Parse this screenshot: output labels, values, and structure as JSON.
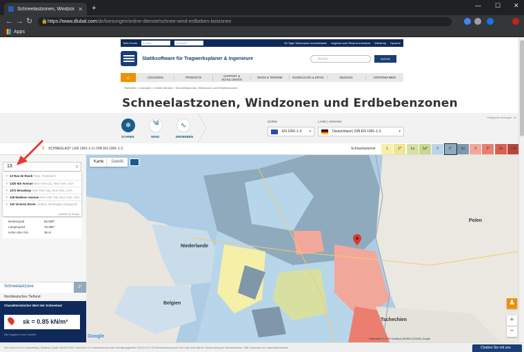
{
  "browser": {
    "tab_title": "Schneelastzonen, Windzonen und",
    "url_domain": "https://www.dlubal.com",
    "url_path": "/de/loesungen/online-dienste/schnee-wind-erdbeben-lastzonen",
    "bookmarks_apps": "Apps"
  },
  "site": {
    "topbar": {
      "my_account": "Mein Konto",
      "email_placeholder": "E-Mail",
      "password_placeholder": "Passwort",
      "trial": "90-Tage-Testversion herunterladen",
      "callback": "Angebot oder Rückruf anfordern",
      "webshop": "Webshop",
      "language": "Sprache"
    },
    "brand": "Statiksoftware für Tragwerksplaner & Ingenieure",
    "search_placeholder": "Suche",
    "search_button": "SUCHE",
    "menu": [
      "LÖSUNGEN",
      "PRODUKTE",
      "SUPPORT & SCHULUNGEN",
      "NEWS & TERMINE",
      "DOWNLOADS & INFOS",
      "BILDUNG",
      "UNTERNEHMEN"
    ],
    "breadcrumb": "Startseite  >  Lösungen  >  Online-Dienste  >  Schneelastzonen, Windzonen und Erdbebenzonen",
    "page_title": "Schneelastzonen, Windzonen und Erdbebenzonen",
    "hint": "Geltigkeits-Anfragen: 10"
  },
  "load_types": [
    {
      "label": "SCHNEE",
      "icon": "❄"
    },
    {
      "label": "WIND",
      "icon": "༄"
    },
    {
      "label": "ERDBEBEN",
      "icon": "∿"
    }
  ],
  "norm": {
    "label": "NORM",
    "value": "EN 1991-1-3"
  },
  "land": {
    "label": "LAND | ANHANG",
    "value": "Deutschland | DIN EN 1991-1-3"
  },
  "strip": {
    "text": "SCHNEELAST  |  EN 1991-1-3  |  DIN EN 1991-1-3",
    "zone_label": "Schneelastzone",
    "zones": [
      {
        "label": "1",
        "color": "#f5efa8"
      },
      {
        "label": "1*",
        "color": "#efe692"
      },
      {
        "label": "1a",
        "color": "#d7e0a0"
      },
      {
        "label": "1a*",
        "color": "#c8d890"
      },
      {
        "label": "2",
        "color": "#b8d6ea"
      },
      {
        "label": "2*",
        "color": "#8faabd"
      },
      {
        "label": "2a",
        "color": "#7f97a8"
      },
      {
        "label": "3",
        "color": "#f2a79b"
      },
      {
        "label": "3*",
        "color": "#ea7f70"
      },
      {
        "label": "3a",
        "color": "#d9604f"
      },
      {
        "label": ">3a",
        "color": "#b8453a"
      }
    ]
  },
  "map": {
    "tab_map": "Karte",
    "tab_satellite": "Satellit",
    "countries": {
      "polen": "Polen",
      "niederlande": "Niederlande",
      "belgien": "Belgien",
      "tschechien": "Tschechien"
    },
    "copyright": "Kartendaten © 2019 GeoBasis-DE/BKG (©2009), Google",
    "google": "Google",
    "zoom_in": "+",
    "zoom_out": "−"
  },
  "panel": {
    "search_value": "13",
    "suggestions": [
      {
        "name": "13 Rue de Rivoli",
        "place": "Paris, Frankreich"
      },
      {
        "name": "1330 6th Avenue",
        "place": "New York City, New York, USA"
      },
      {
        "name": "1372 Broadway",
        "place": "New York City, New York, USA"
      },
      {
        "name": "135 Madison Avenue",
        "place": "New York City, New York, USA"
      },
      {
        "name": "133 Victoria Street",
        "place": "London, Vereinigtes Königreich"
      }
    ],
    "powered_by": "powered by Google",
    "coords": [
      {
        "label": "Breitengrad",
        "value": "52.520°"
      },
      {
        "label": "Längengrad",
        "value": "13.405°"
      },
      {
        "label": "Höhe über NN",
        "value": "36 m"
      }
    ],
    "zone_label": "Schneelastzone",
    "zone_value": "2*",
    "region": "Norddeutsches Tiefland",
    "char_title": "Charakteristischer Wert der Schneelast",
    "char_value": "sk = 0.85 kN/m²",
    "disclaimer": "Alle Angaben ohne Gewähr"
  },
  "status_bar": "Geo-Zonen-Tool für Lastermittlung  |  Webshop  |  Quelle: DIN EN 1991-1-3/NA:2010-12  |  Schneelastzonen nach Verwaltungsgebieten 2019-01-20  |  LTB-Windeinwirkung-Karte 2013  |  http://www.dibt.de/  |  Neuzuordnung der Schneelastzonen, DIBt  |  Information der Landesbauministerien",
  "chat": "Chatten Sie mit uns"
}
